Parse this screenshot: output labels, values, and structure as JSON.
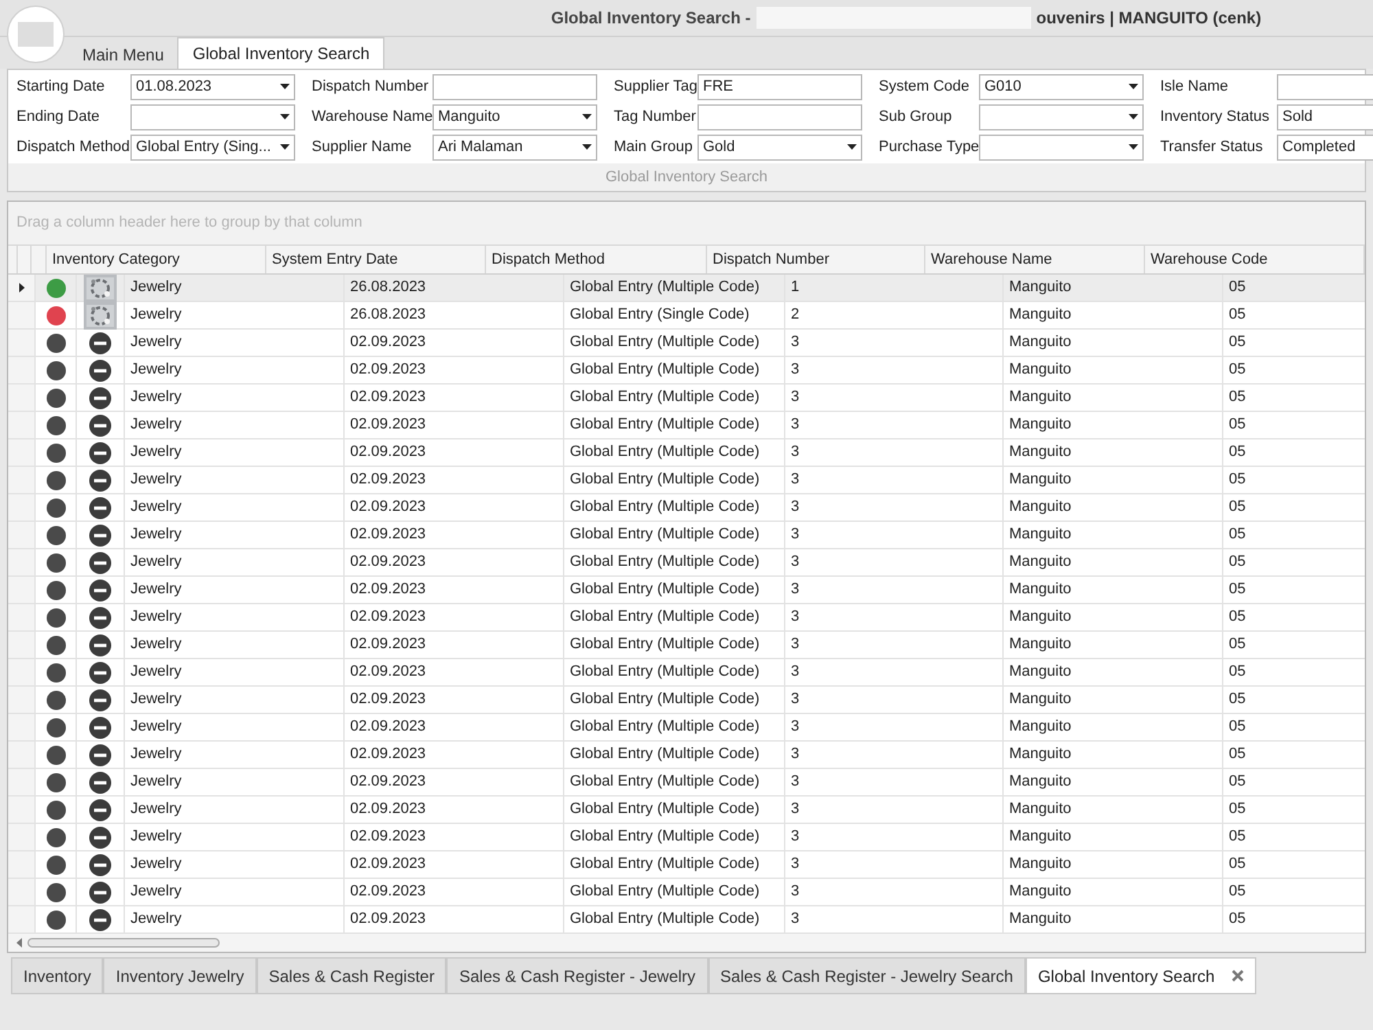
{
  "window": {
    "title_start": "Global Inventory Search -",
    "title_end": "ouvenirs | MANGUITO (cenk)"
  },
  "tabs": [
    {
      "label": "Main Menu",
      "selected": false
    },
    {
      "label": "Global Inventory Search",
      "selected": true
    }
  ],
  "filters": [
    {
      "label": "Starting Date",
      "value": "01.08.2023",
      "kind": "dropdown"
    },
    {
      "label": "Dispatch Number",
      "kind": "text"
    },
    {
      "label": "Supplier Tag",
      "value": "FRE",
      "kind": "text"
    },
    {
      "label": "System Code",
      "value": "G010",
      "kind": "dropdown"
    },
    {
      "label": "Isle Name",
      "kind": "text"
    },
    {
      "label": "Ending Date",
      "kind": "dropdown"
    },
    {
      "label": "Warehouse Name",
      "value": "Manguito",
      "kind": "dropdown"
    },
    {
      "label": "Tag Number",
      "kind": "text"
    },
    {
      "label": "Sub Group",
      "kind": "dropdown"
    },
    {
      "label": "Inventory Status",
      "value": "Sold",
      "kind": "text"
    },
    {
      "label": "Dispatch Method",
      "value": "Global Entry (Sing...",
      "kind": "dropdown"
    },
    {
      "label": "Supplier Name",
      "value": "Ari Malaman",
      "kind": "dropdown"
    },
    {
      "label": "Main Group",
      "value": "Gold",
      "kind": "dropdown"
    },
    {
      "label": "Purchase Type",
      "kind": "dropdown"
    },
    {
      "label": "Transfer Status",
      "value": "Completed",
      "kind": "text"
    }
  ],
  "section_caption": "Global Inventory Search",
  "group_panel": "Drag a column header here to group by that column",
  "table": {
    "columns": [
      "Inventory Category",
      "System Entry Date",
      "Dispatch Method",
      "Dispatch Number",
      "Warehouse Name",
      "Warehouse Code"
    ],
    "rows": [
      {
        "selected": true,
        "color": "#3d9c45",
        "kind": "picture",
        "cells": [
          "Jewelry",
          "26.08.2023",
          "Global Entry (Multiple Code)",
          "1",
          "Manguito",
          "05"
        ]
      },
      {
        "selected": false,
        "color": "#e0434f",
        "kind": "picture",
        "cells": [
          "Jewelry",
          "26.08.2023",
          "Global Entry (Single Code)",
          "2",
          "Manguito",
          "05"
        ]
      },
      {
        "selected": false,
        "color": "#4a4a4a",
        "kind": "none",
        "cells": [
          "Jewelry",
          "02.09.2023",
          "Global Entry (Multiple Code)",
          "3",
          "Manguito",
          "05"
        ]
      },
      {
        "selected": false,
        "color": "#4a4a4a",
        "kind": "none",
        "cells": [
          "Jewelry",
          "02.09.2023",
          "Global Entry (Multiple Code)",
          "3",
          "Manguito",
          "05"
        ]
      },
      {
        "selected": false,
        "color": "#4a4a4a",
        "kind": "none",
        "cells": [
          "Jewelry",
          "02.09.2023",
          "Global Entry (Multiple Code)",
          "3",
          "Manguito",
          "05"
        ]
      },
      {
        "selected": false,
        "color": "#4a4a4a",
        "kind": "none",
        "cells": [
          "Jewelry",
          "02.09.2023",
          "Global Entry (Multiple Code)",
          "3",
          "Manguito",
          "05"
        ]
      },
      {
        "selected": false,
        "color": "#4a4a4a",
        "kind": "none",
        "cells": [
          "Jewelry",
          "02.09.2023",
          "Global Entry (Multiple Code)",
          "3",
          "Manguito",
          "05"
        ]
      },
      {
        "selected": false,
        "color": "#4a4a4a",
        "kind": "none",
        "cells": [
          "Jewelry",
          "02.09.2023",
          "Global Entry (Multiple Code)",
          "3",
          "Manguito",
          "05"
        ]
      },
      {
        "selected": false,
        "color": "#4a4a4a",
        "kind": "none",
        "cells": [
          "Jewelry",
          "02.09.2023",
          "Global Entry (Multiple Code)",
          "3",
          "Manguito",
          "05"
        ]
      },
      {
        "selected": false,
        "color": "#4a4a4a",
        "kind": "none",
        "cells": [
          "Jewelry",
          "02.09.2023",
          "Global Entry (Multiple Code)",
          "3",
          "Manguito",
          "05"
        ]
      },
      {
        "selected": false,
        "color": "#4a4a4a",
        "kind": "none",
        "cells": [
          "Jewelry",
          "02.09.2023",
          "Global Entry (Multiple Code)",
          "3",
          "Manguito",
          "05"
        ]
      },
      {
        "selected": false,
        "color": "#4a4a4a",
        "kind": "none",
        "cells": [
          "Jewelry",
          "02.09.2023",
          "Global Entry (Multiple Code)",
          "3",
          "Manguito",
          "05"
        ]
      },
      {
        "selected": false,
        "color": "#4a4a4a",
        "kind": "none",
        "cells": [
          "Jewelry",
          "02.09.2023",
          "Global Entry (Multiple Code)",
          "3",
          "Manguito",
          "05"
        ]
      },
      {
        "selected": false,
        "color": "#4a4a4a",
        "kind": "none",
        "cells": [
          "Jewelry",
          "02.09.2023",
          "Global Entry (Multiple Code)",
          "3",
          "Manguito",
          "05"
        ]
      },
      {
        "selected": false,
        "color": "#4a4a4a",
        "kind": "none",
        "cells": [
          "Jewelry",
          "02.09.2023",
          "Global Entry (Multiple Code)",
          "3",
          "Manguito",
          "05"
        ]
      },
      {
        "selected": false,
        "color": "#4a4a4a",
        "kind": "none",
        "cells": [
          "Jewelry",
          "02.09.2023",
          "Global Entry (Multiple Code)",
          "3",
          "Manguito",
          "05"
        ]
      },
      {
        "selected": false,
        "color": "#4a4a4a",
        "kind": "none",
        "cells": [
          "Jewelry",
          "02.09.2023",
          "Global Entry (Multiple Code)",
          "3",
          "Manguito",
          "05"
        ]
      },
      {
        "selected": false,
        "color": "#4a4a4a",
        "kind": "none",
        "cells": [
          "Jewelry",
          "02.09.2023",
          "Global Entry (Multiple Code)",
          "3",
          "Manguito",
          "05"
        ]
      },
      {
        "selected": false,
        "color": "#4a4a4a",
        "kind": "none",
        "cells": [
          "Jewelry",
          "02.09.2023",
          "Global Entry (Multiple Code)",
          "3",
          "Manguito",
          "05"
        ]
      },
      {
        "selected": false,
        "color": "#4a4a4a",
        "kind": "none",
        "cells": [
          "Jewelry",
          "02.09.2023",
          "Global Entry (Multiple Code)",
          "3",
          "Manguito",
          "05"
        ]
      },
      {
        "selected": false,
        "color": "#4a4a4a",
        "kind": "none",
        "cells": [
          "Jewelry",
          "02.09.2023",
          "Global Entry (Multiple Code)",
          "3",
          "Manguito",
          "05"
        ]
      },
      {
        "selected": false,
        "color": "#4a4a4a",
        "kind": "none",
        "cells": [
          "Jewelry",
          "02.09.2023",
          "Global Entry (Multiple Code)",
          "3",
          "Manguito",
          "05"
        ]
      },
      {
        "selected": false,
        "color": "#4a4a4a",
        "kind": "none",
        "cells": [
          "Jewelry",
          "02.09.2023",
          "Global Entry (Multiple Code)",
          "3",
          "Manguito",
          "05"
        ]
      },
      {
        "selected": false,
        "color": "#4a4a4a",
        "kind": "none",
        "cells": [
          "Jewelry",
          "02.09.2023",
          "Global Entry (Multiple Code)",
          "3",
          "Manguito",
          "05"
        ]
      }
    ]
  },
  "document_tabs": [
    {
      "label": "Inventory",
      "selected": false,
      "closable": false
    },
    {
      "label": "Inventory Jewelry",
      "selected": false,
      "closable": false
    },
    {
      "label": "Sales & Cash Register",
      "selected": false,
      "closable": false
    },
    {
      "label": "Sales & Cash Register - Jewelry",
      "selected": false,
      "closable": false
    },
    {
      "label": "Sales & Cash Register - Jewelry Search",
      "selected": false,
      "closable": false
    },
    {
      "label": "Global Inventory Search",
      "selected": true,
      "closable": true
    }
  ]
}
